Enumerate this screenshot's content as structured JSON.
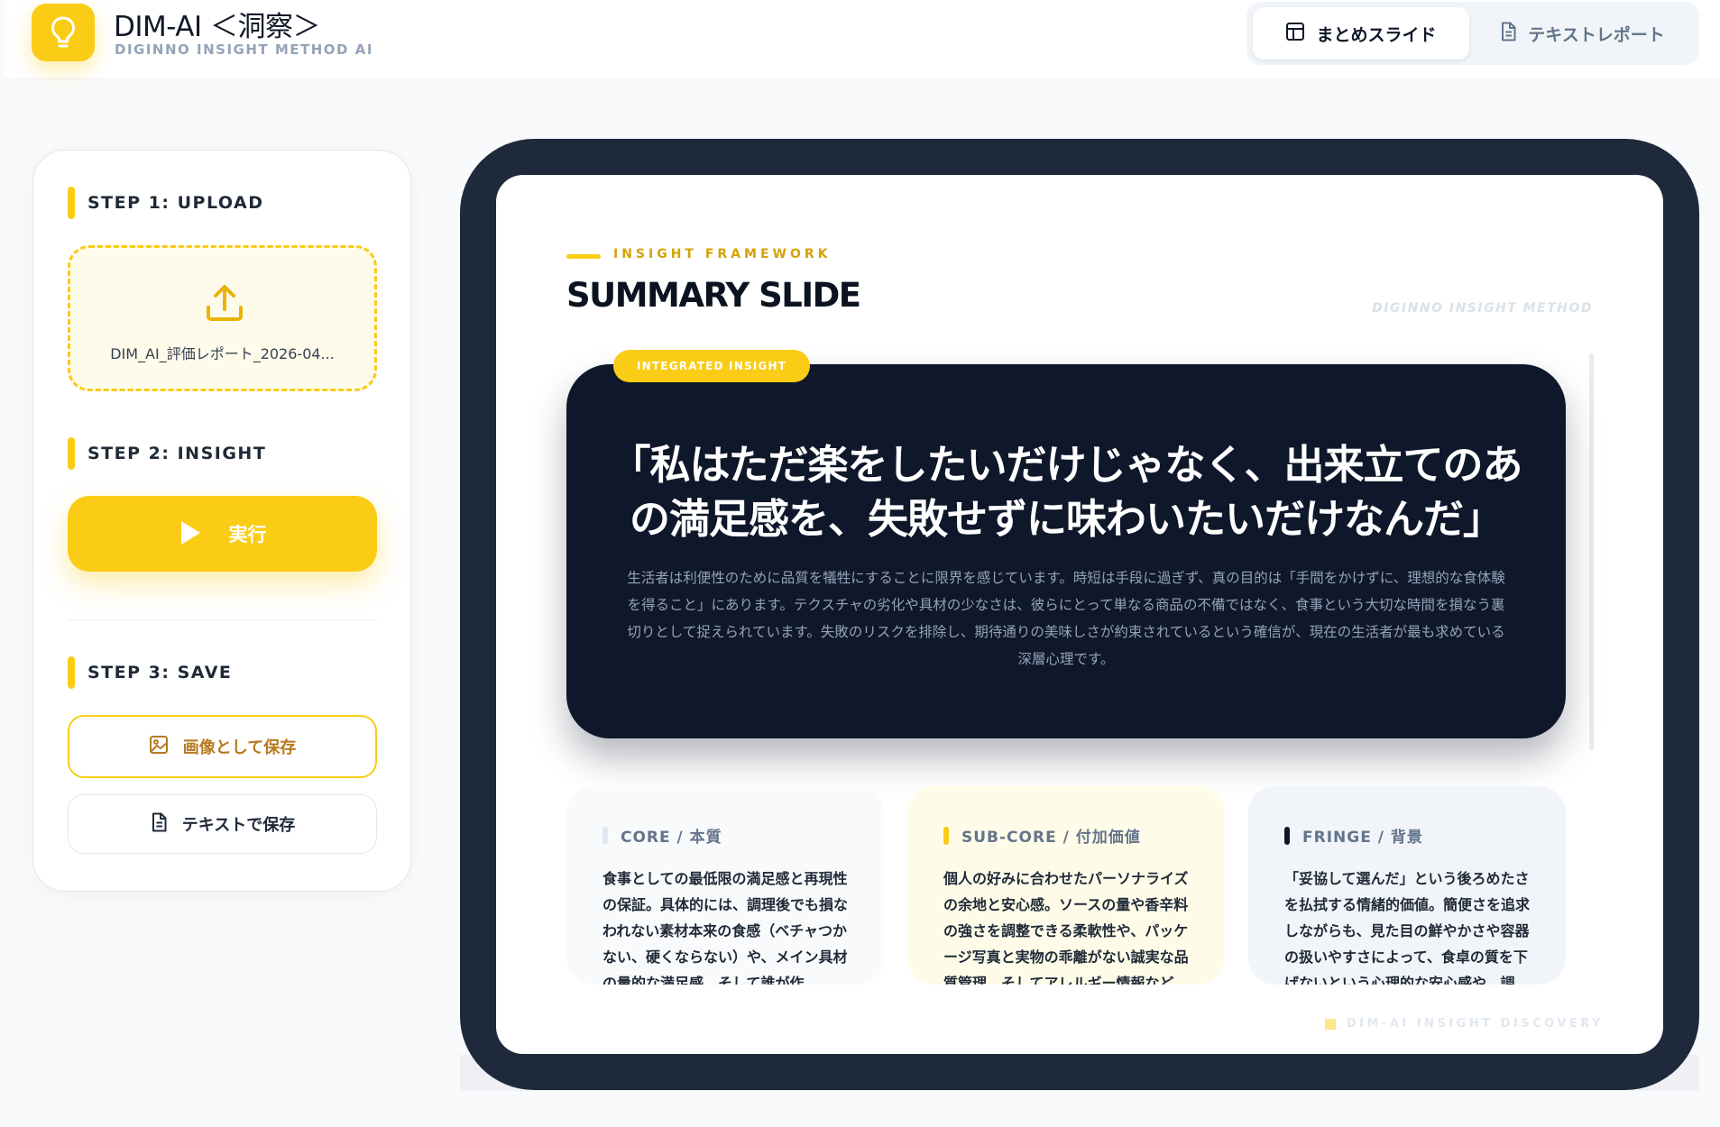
{
  "header": {
    "title": "DIM-AI ＜洞察＞",
    "subtitle": "DIGINNO INSIGHT METHOD AI",
    "tabs": [
      {
        "label": "まとめスライド",
        "icon": "layout-icon",
        "active": true
      },
      {
        "label": "テキストレポート",
        "icon": "document-icon",
        "active": false
      }
    ]
  },
  "sidebar": {
    "step1": {
      "label": "STEP 1: UPLOAD",
      "file_name": "DIM_AI_評価レポート_2026-04..."
    },
    "step2": {
      "label": "STEP 2: INSIGHT",
      "run_label": "実行"
    },
    "step3": {
      "label": "STEP 3: SAVE",
      "save_image_label": "画像として保存",
      "save_text_label": "テキストで保存"
    }
  },
  "slide": {
    "framework_label": "INSIGHT FRAMEWORK",
    "title": "SUMMARY SLIDE",
    "brand": "DIGINNO INSIGHT METHOD",
    "insight": {
      "badge": "INTEGRATED INSIGHT",
      "quote": "「私はただ楽をしたいだけじゃなく、出来立てのあの満足感を、失敗せずに味わいたいだけなんだ」",
      "body": "生活者は利便性のために品質を犠牲にすることに限界を感じています。時短は手段に過ぎず、真の目的は「手間をかけずに、理想的な食体験を得ること」にあります。テクスチャの劣化や具材の少なさは、彼らにとって単なる商品の不備ではなく、食事という大切な時間を損なう裏切りとして捉えられています。失敗のリスクを排除し、期待通りの美味しさが約束されているという確信が、現在の生活者が最も求めている深層心理です。"
    },
    "cards": [
      {
        "title": "CORE / 本質",
        "body": "食事としての最低限の満足感と再現性の保証。具体的には、調理後でも損なわれない素材本来の食感（ベチャつかない、硬くならない）や、メイン具材の量的な満足感、そして誰が作"
      },
      {
        "title": "SUB-CORE / 付加価値",
        "body": "個人の好みに合わせたパーソナライズの余地と安心感。ソースの量や香辛料の強さを調整できる柔軟性や、パッケージ写真と実物の乖離がない誠実な品質管理、そしてアレルギー情報など"
      },
      {
        "title": "FRINGE / 背景",
        "body": "「妥協して選んだ」という後ろめたさを払拭する情緒的価値。簡便さを追求しながらも、見た目の鮮やかさや容器の扱いやすさによって、食卓の質を下げないという心理的な安心感や、調"
      }
    ],
    "footer": "DIM-AI INSIGHT DISCOVERY"
  },
  "colors": {
    "accent": "#facc15",
    "dark": "#0f172a",
    "frame": "#1e293b",
    "card_core_bar": "#e2e8f0",
    "card_sub_bar": "#facc15",
    "card_fringe_bar": "#0f172a"
  }
}
